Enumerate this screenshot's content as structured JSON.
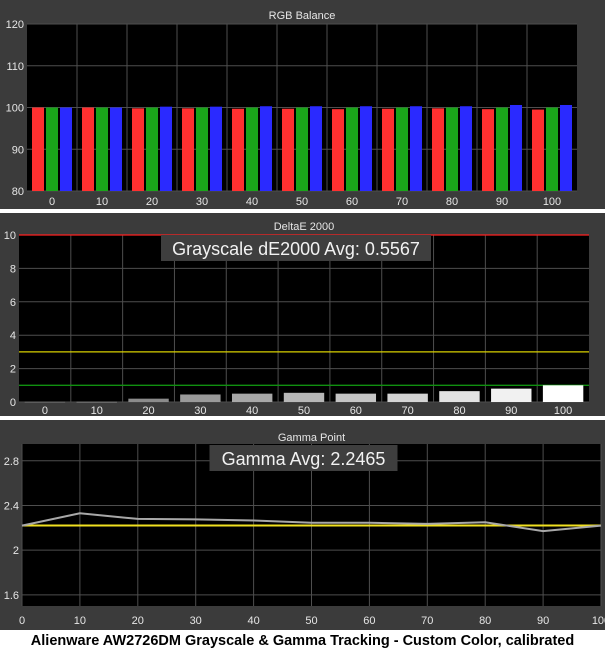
{
  "caption": "Alienware AW2726DM Grayscale & Gamma Tracking - Custom Color, calibrated",
  "colors": {
    "panel_bg": "#3b3b3b",
    "plot_bg": "#000000",
    "grid": "#4e4e4e",
    "text": "#e6e6e6",
    "red": "#ff3030",
    "green": "#1aa51a",
    "blue": "#2a2aff",
    "gray_bar": "#9a9a9a",
    "white_bar": "#ffffff",
    "gamma_line": "#a8a8a8",
    "target_yellow": "#f0e020",
    "threshold_red": "#ff2020",
    "threshold_yellow": "#d8d000",
    "threshold_green": "#109010"
  },
  "chart_data": [
    {
      "type": "bar",
      "title": "RGB Balance",
      "categories": [
        "0",
        "10",
        "20",
        "30",
        "40",
        "50",
        "60",
        "70",
        "80",
        "90",
        "100"
      ],
      "series": [
        {
          "name": "",
          "color": "red",
          "values": [
            100,
            100,
            99.8,
            99.8,
            99.7,
            99.7,
            99.6,
            99.7,
            99.8,
            99.6,
            99.5
          ]
        },
        {
          "name": "",
          "color": "green",
          "values": [
            100,
            100,
            100,
            100,
            100,
            100,
            100,
            100,
            100,
            100,
            100
          ]
        },
        {
          "name": "",
          "color": "blue",
          "values": [
            100,
            100,
            100.2,
            100.2,
            100.3,
            100.3,
            100.3,
            100.3,
            100.3,
            100.6,
            100.6
          ]
        }
      ],
      "ylim": [
        80,
        120
      ],
      "yticks": [
        80,
        90,
        100,
        110,
        120
      ],
      "grid": true
    },
    {
      "type": "bar",
      "title": "DeltaE 2000",
      "annotation": "Grayscale dE2000 Avg: 0.5567",
      "categories": [
        "0",
        "10",
        "20",
        "30",
        "40",
        "50",
        "60",
        "70",
        "80",
        "90",
        "100"
      ],
      "values": [
        0.02,
        0.02,
        0.2,
        0.45,
        0.5,
        0.55,
        0.5,
        0.5,
        0.65,
        0.8,
        1.0
      ],
      "thresholds": [
        10,
        3,
        1
      ],
      "ylim": [
        0,
        10
      ],
      "yticks": [
        0,
        2,
        4,
        6,
        8,
        10
      ],
      "grid": true
    },
    {
      "type": "line",
      "title": "Gamma Point",
      "annotation": "Gamma Avg: 2.2465",
      "x": [
        0,
        10,
        20,
        30,
        40,
        50,
        60,
        70,
        80,
        90,
        100
      ],
      "y": [
        2.22,
        2.33,
        2.28,
        2.275,
        2.265,
        2.245,
        2.245,
        2.235,
        2.25,
        2.17,
        2.22
      ],
      "target": 2.22,
      "xlim": [
        0,
        100
      ],
      "xticks": [
        0,
        10,
        20,
        30,
        40,
        50,
        60,
        70,
        80,
        90,
        100
      ],
      "ylim": [
        1.5,
        2.95
      ],
      "yticks": [
        1.6,
        2,
        2.4,
        2.8
      ],
      "grid": true
    }
  ]
}
